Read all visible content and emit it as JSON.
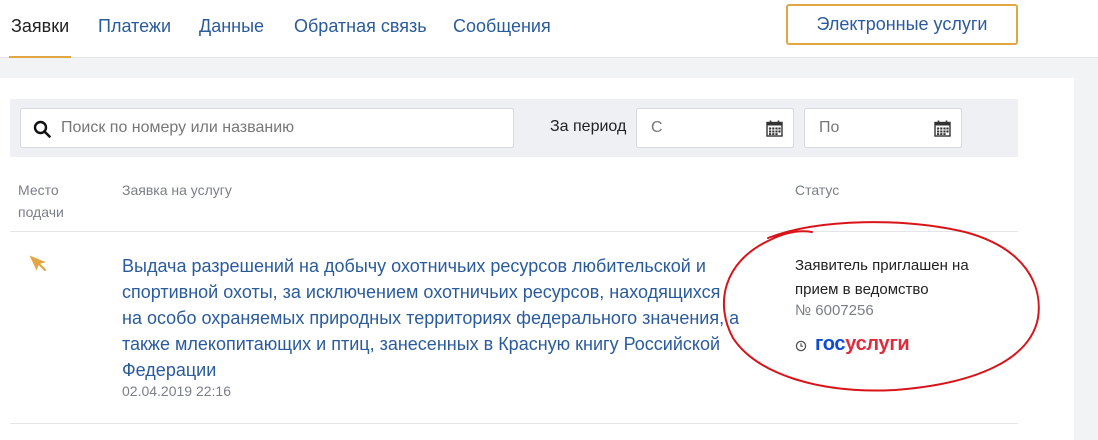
{
  "nav": {
    "tabs": [
      {
        "label": "Заявки",
        "active": true
      },
      {
        "label": "Платежи"
      },
      {
        "label": "Данные"
      },
      {
        "label": "Обратная связь"
      },
      {
        "label": "Сообщения"
      }
    ],
    "eservices_label": "Электронные услуги"
  },
  "filter": {
    "search_placeholder": "Поиск по номеру или названию",
    "period_label": "За период",
    "from_placeholder": "С",
    "to_placeholder": "По"
  },
  "table": {
    "columns": {
      "location_line1": "Место",
      "location_line2": "подачи",
      "service": "Заявка на услугу",
      "status": "Статус"
    },
    "rows": [
      {
        "service_title": "Выдача разрешений на добычу охотничьих ресурсов любительской и спортивной охоты, за исключением охотничьих ресурсов, находящихся на особо охраняемых природных территориях федерального значения, а также млекопитающих и птиц, занесенных в Красную книгу Российской Федерации",
        "date": "02.04.2019 22:16",
        "status": "Заявитель приглашен на прием в ведомство",
        "number": "№ 6007256",
        "brand_part1": "гос",
        "brand_part2": "услуги"
      }
    ]
  },
  "colors": {
    "accent": "#e2a642",
    "link": "#2a5b9c",
    "annotation": "#d8141a",
    "brand_blue": "#0d4cd3",
    "brand_red": "#e02b3c"
  }
}
